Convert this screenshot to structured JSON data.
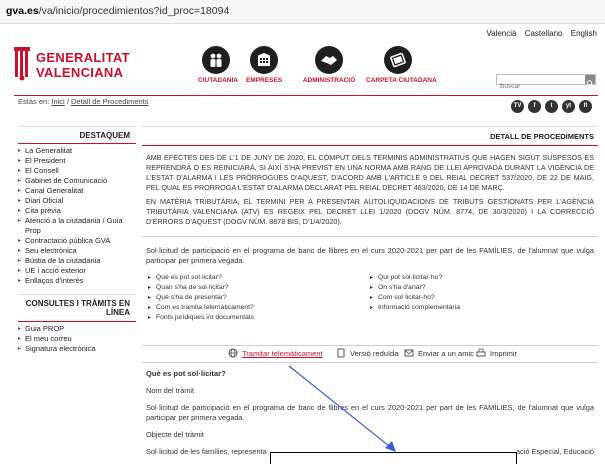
{
  "browser": {
    "url_domain": "gva.es",
    "url_path": "/va/inicio/procedimientos?id_proc=18094"
  },
  "languages": [
    "Valencià",
    "Castellano",
    "English"
  ],
  "logo": {
    "line1": "GENERALITAT",
    "line2": "VALENCIANA"
  },
  "nav": [
    {
      "label": "CIUTADANIA",
      "icon": "citizens-icon"
    },
    {
      "label": "EMPRESES",
      "icon": "building-icon"
    },
    {
      "label": "ADMINISTRACIÓ",
      "icon": "handshake-icon"
    },
    {
      "label": "CARPETA CIUTADANA",
      "icon": "folder-icon"
    }
  ],
  "search": {
    "placeholder": "Buscar"
  },
  "breadcrumb": {
    "prefix": "Estàs en:",
    "home": "Inici",
    "sep": "/",
    "current": "Detall de Procediments"
  },
  "social": [
    "TV",
    "f",
    "t",
    "yt",
    "fl"
  ],
  "sidebar": {
    "section1_title": "DESTAQUEM",
    "section1_items": [
      "La Generalitat",
      "El President",
      "El Consell",
      "Gabinet de Comunicació",
      "Canal Generalitat",
      "Diari Oficial",
      "Cita prèvia",
      "Atenció a la ciutadania / Guia Prop",
      "Contractació pública GVA",
      "Seu electrònica",
      "Bústia de la ciutadania",
      "UE i acció exterior",
      "Enllaços d'interès"
    ],
    "section2_title_1": "CONSULTES I TRÀMITS EN",
    "section2_title_2": "LÍNEA",
    "section2_items": [
      "Guia PROP",
      "El meu correu",
      "Signatura electrònica"
    ]
  },
  "main": {
    "header": "DETALL DE PROCEDIMENTS",
    "notice1": "AMB EFECTES DES DE L'1 DE JUNY DE 2020, EL CÒMPUT DELS TERMINIS ADMINISTRATIUS QUE HAGEN SIGUT SUSPESOS ES REPRENDRÀ O ES REINICIARÀ, SI AIXÍ S'HA PREVIST EN UNA NORMA AMB RANG DE LLEI APROVADA DURANT LA VIGÈNCIA DE L'ESTAT D'ALARMA I LES PRÒRROGUES D'AQUEST, D'ACORD AMB L'ARTICLE 9 DEL REIAL DECRET 537/2020, DE 22 DE MAIG, PEL QUAL ES PRORROGA L'ESTAT D'ALARMA DECLARAT PEL REIAL DECRET 463/2020, DE 14 DE MARÇ.",
    "notice2": "EN MATÈRIA TRIBUTÀRIA, EL TERMINI PER A PRESENTAR AUTOLIQUIDACIONS DE TRIBUTS GESTIONATS PER L'AGÈNCIA TRIBUTÀRIA VALENCIANA (ATV) ES REGEIX PEL DECRET LLEI 1/2020 (DOGV NÚM. 8774, DE 30/3/2020) I LA CORRECCIÓ D'ERRORS D'AQUEST (DOGV NÚM. 8878 BIS, D'1/4/2020).",
    "intro": "Sol·licitud de participació en el programa de banc de llibres en el curs 2020-2021 per part de les FAMÍLIES, de l'alumnat que vulga participar per primera vegada.",
    "links_left": [
      "Què es pot sol·licitar?",
      "Quan s'ha de sol·licitar?",
      "Què s'ha de presentar?",
      "Com es tramita telemàticament?",
      "Fonts jurídiques i/o documentals"
    ],
    "links_right": [
      "Qui pot sol·licitar-ho?",
      "On s'ha d'anar?",
      "Com sol·licitar-ho?",
      "Informació complementària"
    ],
    "actions": {
      "tramitar": "Tramitar telemàticament",
      "reduida": "Versió reduïda",
      "amic": "Enviar a un amic",
      "imprimir": "Imprimir"
    },
    "q1": "Què es pot sol·licitar?",
    "nom_h": "Nom del tràmit",
    "nom_text": "Sol·licitud de participació en el programa de banc de llibres en el curs 2020-2021 per part de les FAMÍLIES, de l'alumnat que vulga participar per primera vegada.",
    "obj_h": "Objecte del tràmit",
    "obj_text_start": "Sol·licitud de les famílies, representa",
    "obj_text_end": "ació Especial, Educació"
  }
}
